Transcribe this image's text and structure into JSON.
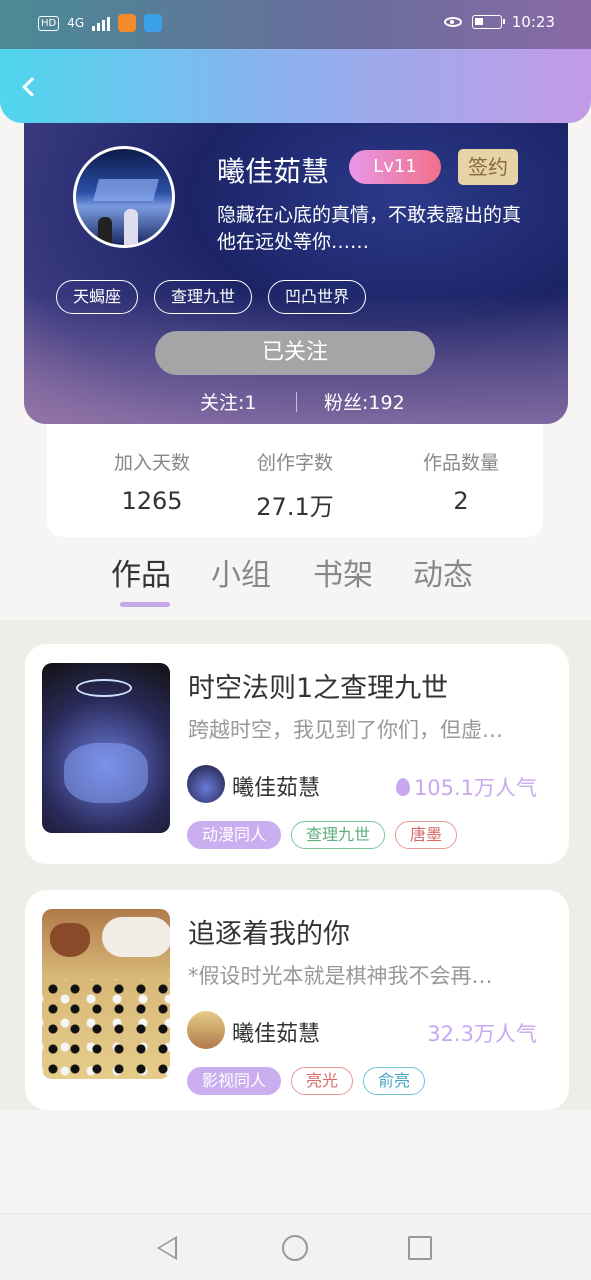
{
  "status_bar": {
    "left_indicators": [
      "HD",
      "4G"
    ],
    "time": "10:23"
  },
  "header": {
    "back_icon": "chevron-left-icon"
  },
  "profile": {
    "username": "曦佳茹慧",
    "level": "Lv11",
    "signed_badge": "签约",
    "bio": "隐藏在心底的真情，不敢表露出的真\n他在远处等你……",
    "tags": [
      "天蝎座",
      "查理九世",
      "凹凸世界"
    ],
    "follow_button": "已关注",
    "following": "关注:1",
    "followers": "粉丝:192"
  },
  "stats": [
    {
      "label": "加入天数",
      "value": "1265"
    },
    {
      "label": "创作字数",
      "value": "27.1万"
    },
    {
      "label": "作品数量",
      "value": "2"
    }
  ],
  "tabs": [
    {
      "label": "作品",
      "active": true
    },
    {
      "label": "小组",
      "active": false
    },
    {
      "label": "书架",
      "active": false
    },
    {
      "label": "动态",
      "active": false
    }
  ],
  "works": [
    {
      "title": "时空法则1之查理九世",
      "desc": "跨越时空，我见到了你们，但虚…",
      "author": "曦佳茹慧",
      "popularity": "105.1万人气",
      "tags": [
        {
          "label": "动漫同人",
          "style": "purple"
        },
        {
          "label": "查理九世",
          "style": "green"
        },
        {
          "label": "唐墨",
          "style": "red"
        }
      ]
    },
    {
      "title": "追逐着我的你",
      "desc": "*假设时光本就是棋神我不会再…",
      "author": "曦佳茹慧",
      "popularity": "32.3万人气",
      "tags": [
        {
          "label": "影视同人",
          "style": "purple"
        },
        {
          "label": "亮光",
          "style": "red"
        },
        {
          "label": "俞亮",
          "style": "cyan"
        }
      ]
    }
  ],
  "colors": {
    "accent": "#c8a8ee",
    "header_start": "#4fd6ee",
    "header_end": "#c39be6",
    "level_badge": "#f0708a",
    "signed_badge": "#e6d3a8"
  }
}
